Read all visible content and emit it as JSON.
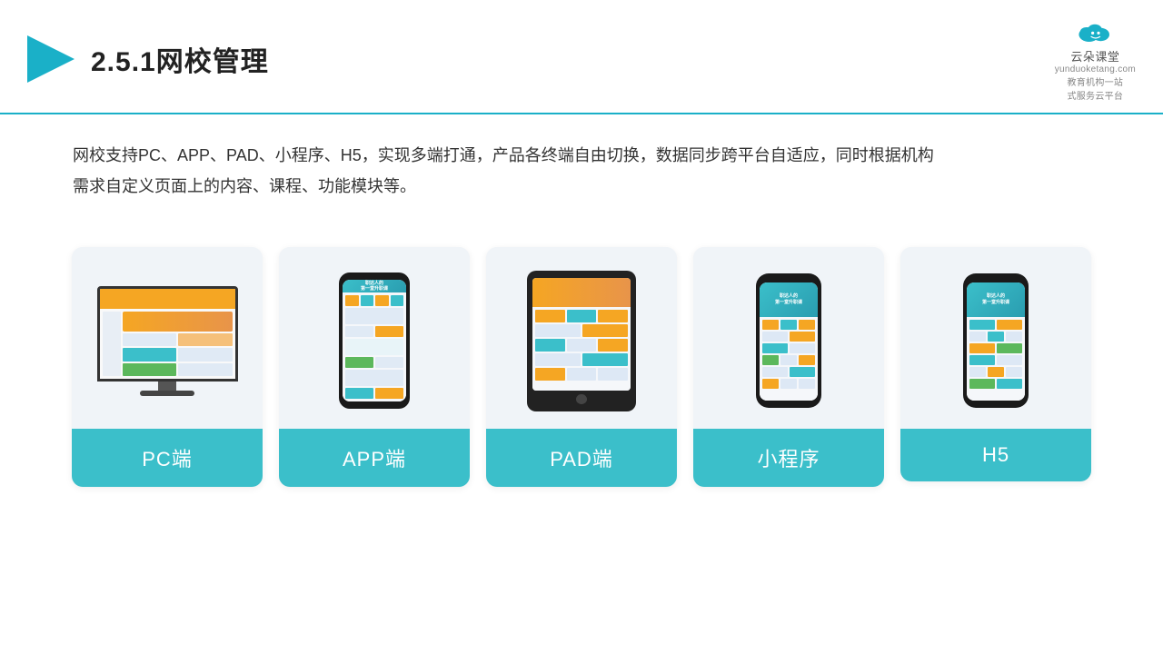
{
  "header": {
    "title": "2.5.1网校管理",
    "logo_name": "云朵课堂",
    "logo_domain": "yunduoketang.com",
    "logo_slogan": "教育机构一站",
    "logo_slogan2": "式服务云平台"
  },
  "description": {
    "text": "网校支持PC、APP、PAD、小程序、H5，实现多端打通，产品各终端自由切换，数据同步跨平台自适应，同时根据机构需求自定义页面上的内容、课程、功能模块等。"
  },
  "cards": [
    {
      "id": "pc",
      "label": "PC端"
    },
    {
      "id": "app",
      "label": "APP端"
    },
    {
      "id": "pad",
      "label": "PAD端"
    },
    {
      "id": "miniprogram",
      "label": "小程序"
    },
    {
      "id": "h5",
      "label": "H5"
    }
  ],
  "accent_color": "#3bbfca"
}
